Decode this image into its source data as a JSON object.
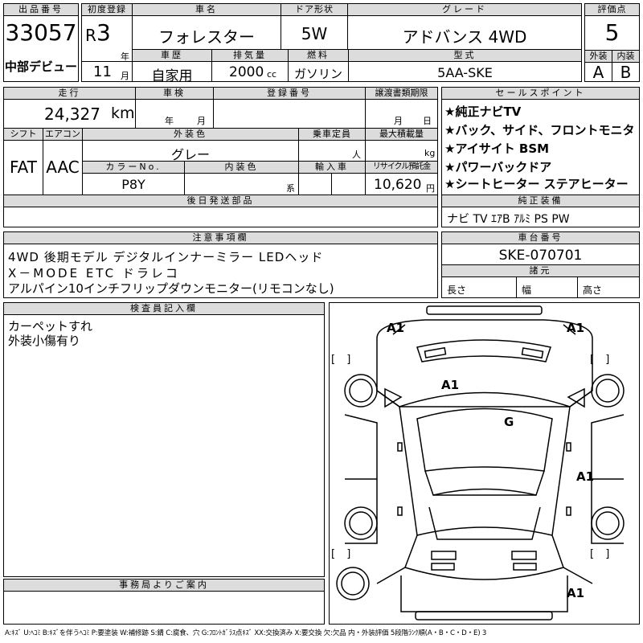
{
  "header": {
    "lot_no_label": "出品番号",
    "lot_no": "33057",
    "debut_label": "中部デビュー",
    "first_reg_label": "初度登録",
    "era": "R",
    "year": "3",
    "year_unit": "年",
    "month": "11",
    "month_unit": "月",
    "car_name_label": "車名",
    "car_name": "フォレスター",
    "door_label": "ドア形状",
    "door": "5W",
    "grade_label": "グレード",
    "grade": "アドバンス 4WD",
    "score_label": "評価点",
    "score": "5",
    "ext_label": "外装",
    "ext": "A",
    "int_label": "内装",
    "int": "B",
    "history_label": "車歴",
    "history": "自家用",
    "displacement_label": "排気量",
    "displacement": "2000",
    "cc": "cc",
    "fuel_label": "燃料",
    "fuel": "ガソリン",
    "model_label": "型式",
    "model": "5AA-SKE"
  },
  "row2": {
    "mileage_label": "走行",
    "mileage": "24,327",
    "km": "km",
    "inspection_label": "車検",
    "insp_year": "年",
    "insp_month": "月",
    "plate_label": "登録番号",
    "transfer_label": "譲渡書類期限",
    "tr_month": "月",
    "tr_day": "日",
    "shift_label": "シフト",
    "shift": "FAT",
    "ac_label": "エアコン",
    "ac": "AAC",
    "ext_color_label": "外装色",
    "ext_color": "グレー",
    "capacity_label": "乗車定員",
    "capacity_unit": "人",
    "max_load_label": "最大積載量",
    "max_load_unit": "kg",
    "color_no_label": "カラーNo.",
    "color_no": "P8Y",
    "int_color_label": "内装色",
    "int_color_unit": "系",
    "import_label": "輸入車",
    "recycle_label": "リサイクル預託金",
    "recycle": "10,620",
    "yen": "円",
    "later_label": "後日発送部品"
  },
  "sales": {
    "label": "セールスポイント",
    "items": [
      "★純正ナビTV",
      "★バック、サイド、フロントモニタ",
      "★アイサイト BSM",
      "★パワーバックドア",
      "★シートヒーター ステアヒーター"
    ]
  },
  "genuine": {
    "label": "純正装備",
    "value": "ナビ TV ｴｱB ｱﾙﾐ PS PW"
  },
  "notes": {
    "label": "注意事項欄",
    "lines": [
      "4WD 後期モデル デジタルインナーミラー LEDヘッド",
      "X－MODE ETC ドラレコ",
      "アルパイン10インチフリップダウンモニター(リモコンなし)"
    ]
  },
  "chassis": {
    "label": "車台番号",
    "value": "SKE-070701",
    "dims_label": "諸元",
    "length": "長さ",
    "width": "幅",
    "height": "高さ"
  },
  "inspector": {
    "label": "検査員記入欄",
    "lines": [
      "カーペットすれ",
      "外装小傷有り"
    ]
  },
  "office": {
    "label": "事務局よりご案内"
  },
  "diagram": {
    "marks": [
      "A1",
      "A1",
      "A1",
      "G",
      "A1",
      "A1"
    ],
    "bracket": "[ ]"
  },
  "legend": "A:ｷｽﾞ U:ﾍｺﾐ B:ｷｽﾞを伴うﾍｺﾐ P:要塗装 W:補修跡 S:錆 C:腐食、穴 G:ﾌﾛﾝﾄｶﾞﾗｽ点ｷｽﾞ XX:交換済み X:要交換 欠:欠品 内・外装評価 5段階ﾗﾝｸ順(A・B・C・D・E) 3"
}
